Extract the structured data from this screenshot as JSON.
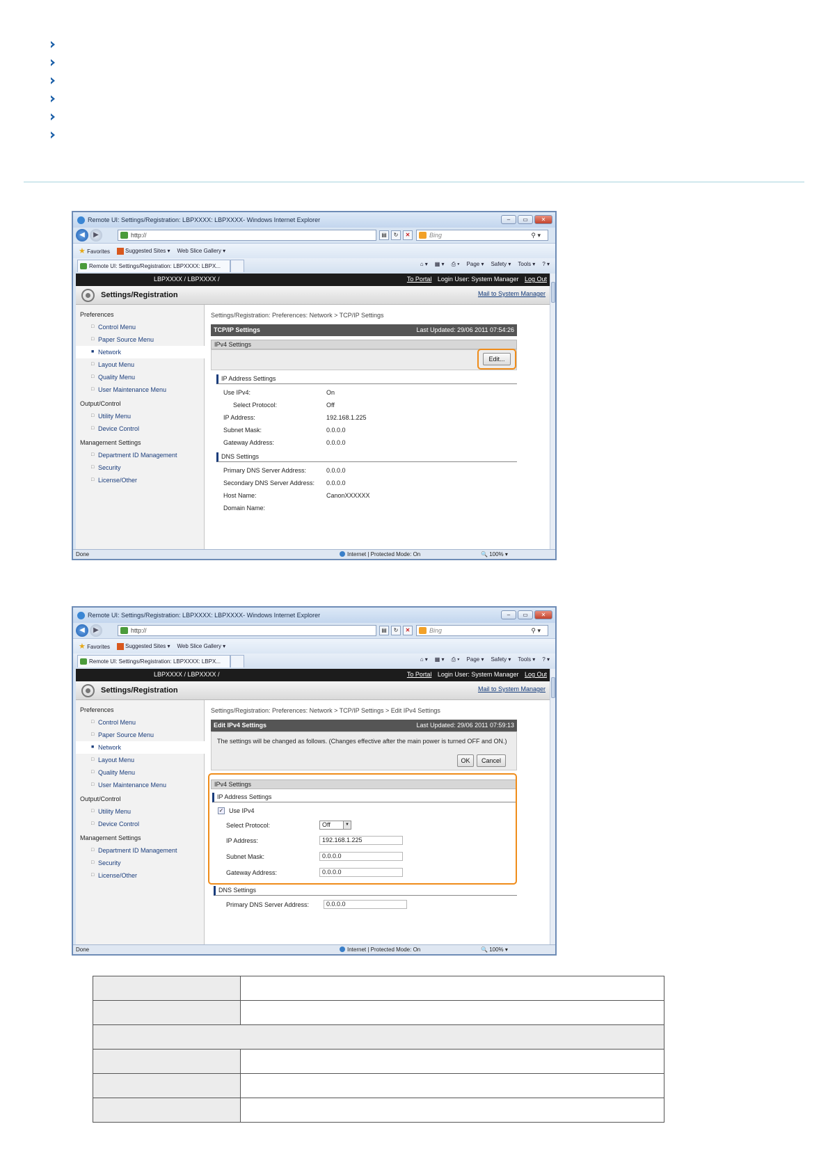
{
  "browser": {
    "window_title": "Remote UI: Settings/Registration: LBPXXXX: LBPXXXX- Windows Internet Explorer",
    "address": "http://",
    "search_placeholder": "Bing",
    "favorites_label": "Favorites",
    "suggested_sites": "Suggested Sites ▾",
    "web_slice_gallery": "Web Slice Gallery ▾",
    "tab_title": "Remote UI: Settings/Registration: LBPXXXX: LBPX...",
    "cmd_page": "Page ▾",
    "cmd_safety": "Safety ▾",
    "cmd_tools": "Tools ▾",
    "status_done": "Done",
    "status_zone": "Internet | Protected Mode: On",
    "status_zoom": "100%"
  },
  "app": {
    "product": "LBPXXXX / LBPXXXX /",
    "to_portal": "To Portal",
    "login_user": "Login User: System Manager",
    "log_out": "Log Out",
    "header_title": "Settings/Registration",
    "mail_link": "Mail to System Manager"
  },
  "sidebar": {
    "group_preferences": "Preferences",
    "control_menu": "Control Menu",
    "paper_source_menu": "Paper Source Menu",
    "network": "Network",
    "layout_menu": "Layout Menu",
    "quality_menu": "Quality Menu",
    "user_maintenance_menu": "User Maintenance Menu",
    "group_output": "Output/Control",
    "utility_menu": "Utility Menu",
    "device_control": "Device Control",
    "group_management": "Management Settings",
    "department_id": "Department ID Management",
    "security": "Security",
    "license_other": "License/Other"
  },
  "screen1": {
    "breadcrumb": "Settings/Registration: Preferences: Network > TCP/IP Settings",
    "section_title": "TCP/IP Settings",
    "last_updated": "Last Updated: 29/06 2011 07:54:26",
    "ipv4_settings": "IPv4 Settings",
    "edit_button": "Edit...",
    "ip_address_settings": "IP Address Settings",
    "use_ipv4_label": "Use IPv4:",
    "use_ipv4_value": "On",
    "select_protocol_label": "Select Protocol:",
    "select_protocol_value": "Off",
    "ip_address_label": "IP Address:",
    "ip_address_value": "192.168.1.225",
    "subnet_mask_label": "Subnet Mask:",
    "subnet_mask_value": "0.0.0.0",
    "gateway_label": "Gateway Address:",
    "gateway_value": "0.0.0.0",
    "dns_settings": "DNS Settings",
    "primary_dns_label": "Primary DNS Server Address:",
    "primary_dns_value": "0.0.0.0",
    "secondary_dns_label": "Secondary DNS Server Address:",
    "secondary_dns_value": "0.0.0.0",
    "host_name_label": "Host Name:",
    "host_name_value": "CanonXXXXXX",
    "domain_name_label": "Domain Name:"
  },
  "screen2": {
    "breadcrumb": "Settings/Registration: Preferences: Network > TCP/IP Settings > Edit IPv4 Settings",
    "section_title": "Edit IPv4 Settings",
    "last_updated": "Last Updated: 29/06 2011 07:59:13",
    "notice": "The settings will be changed as follows. (Changes effective after the main power is turned OFF and ON.)",
    "ok_button": "OK",
    "cancel_button": "Cancel",
    "ipv4_settings": "IPv4 Settings",
    "ip_address_settings": "IP Address Settings",
    "use_ipv4_label": "Use IPv4",
    "select_protocol_label": "Select Protocol:",
    "select_protocol_value": "Off",
    "ip_address_label": "IP Address:",
    "ip_address_value": "192.168.1.225",
    "subnet_mask_label": "Subnet Mask:",
    "subnet_mask_value": "0.0.0.0",
    "gateway_label": "Gateway Address:",
    "gateway_value": "0.0.0.0",
    "dns_settings": "DNS Settings",
    "primary_dns_label": "Primary DNS Server Address:",
    "primary_dns_value": "0.0.0.0"
  },
  "colors": {
    "highlight_ring": "#ef8c1a",
    "divider": "#a8d4de",
    "bullet": "#1a5fa8"
  }
}
